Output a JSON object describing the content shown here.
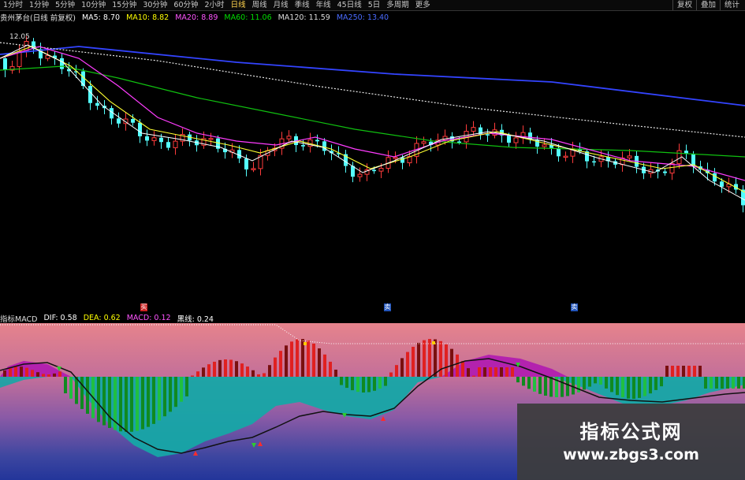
{
  "toolbar": {
    "timeframes": [
      {
        "label": "1分时",
        "active": false
      },
      {
        "label": "1分钟",
        "active": false
      },
      {
        "label": "5分钟",
        "active": false
      },
      {
        "label": "10分钟",
        "active": false
      },
      {
        "label": "15分钟",
        "active": false
      },
      {
        "label": "30分钟",
        "active": false
      },
      {
        "label": "60分钟",
        "active": false
      },
      {
        "label": "2小时",
        "active": false
      },
      {
        "label": "日线",
        "active": true
      },
      {
        "label": "周线",
        "active": false
      },
      {
        "label": "月线",
        "active": false
      },
      {
        "label": "季线",
        "active": false
      },
      {
        "label": "年线",
        "active": false
      },
      {
        "label": "45日线",
        "active": false
      },
      {
        "label": "5日",
        "active": false
      },
      {
        "label": "多周期",
        "active": false
      },
      {
        "label": "更多",
        "active": false
      }
    ],
    "right_buttons": [
      "复权",
      "叠加",
      "统计"
    ]
  },
  "legend": {
    "title": "贵州茅台(日线 前复权)",
    "items": [
      {
        "label": "MA5: 8.70",
        "color": "#ffffff"
      },
      {
        "label": "MA10: 8.82",
        "color": "#ffff00"
      },
      {
        "label": "MA20: 8.89",
        "color": "#ff55ff"
      },
      {
        "label": "MA60: 11.06",
        "color": "#00dd00"
      },
      {
        "label": "MA120: 11.59",
        "color": "#dddddd"
      },
      {
        "label": "MA250: 13.40",
        "color": "#4a6bff"
      }
    ]
  },
  "price_chart": {
    "high_label": "12.05",
    "markers": [
      {
        "label": "买",
        "color": "#cc2222"
      },
      {
        "label": "卖",
        "color": "#2255bb"
      },
      {
        "label": "卖",
        "color": "#2255bb"
      }
    ]
  },
  "macd": {
    "items": [
      {
        "label": "指标MACD",
        "color": "#dddddd"
      },
      {
        "label": "DIF: 0.58",
        "color": "#ffffff"
      },
      {
        "label": "DEA: 0.62",
        "color": "#ffff00"
      },
      {
        "label": "MACD: 0.12",
        "color": "#ff55ff"
      },
      {
        "label": "黑线: 0.24",
        "color": "#ffffff"
      }
    ]
  },
  "watermark": {
    "title": "指标公式网",
    "url": "www.zbgs3.com"
  },
  "colors": {
    "up": "#ff3b3b",
    "down": "#54ffff",
    "hist_up": "#e02020",
    "hist_up_dark": "#7a0f0f",
    "hist_down": "#0f8a20",
    "hist_down_light": "#20c040"
  }
}
